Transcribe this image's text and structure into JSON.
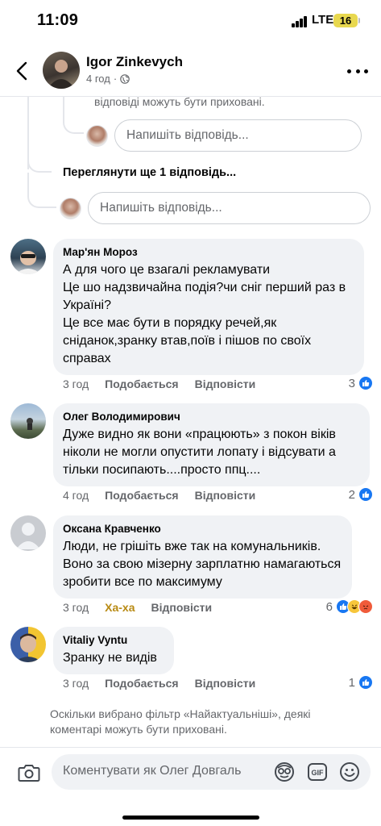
{
  "status_bar": {
    "time": "11:09",
    "network": "LTE",
    "battery": "16"
  },
  "header": {
    "author": "Igor Zinkevych",
    "time": "4 год",
    "separator": "·"
  },
  "thread": {
    "faded_notice": "відповіді можуть бути приховані.",
    "reply_placeholder_1": "Напишіть відповідь...",
    "more_replies": "Переглянути ще 1 відповідь...",
    "reply_placeholder_2": "Напишіть відповідь..."
  },
  "comments": [
    {
      "name": "Мар'ян Мороз",
      "text": "А для чого це взагалі рекламувати\nЦе шо надзвичайна подія?чи сніг перший раз в Україні?\nЦе все має бути в порядку речей,як сніданок,зранку втав,поїв і пішов по своїх справах",
      "time": "3 год",
      "like_label": "Подобається",
      "reply_label": "Відповісти",
      "reaction_count": "3",
      "reactions": [
        "like"
      ]
    },
    {
      "name": "Олег Володимирович",
      "text": "Дуже видно як вони «працюють» з покон віків ніколи не могли опустити лопату і відсувати а тільки посипають....просто ппц....",
      "time": "4 год",
      "like_label": "Подобається",
      "reply_label": "Відповісти",
      "reaction_count": "2",
      "reactions": [
        "like"
      ]
    },
    {
      "name": "Оксана Кравченко",
      "text": "Люди, не грішіть вже так на комунальників. Воно за свою мізерну зарплатню намагаються зробити все по максимуму",
      "time": "3 год",
      "like_label": "Ха-ха",
      "reply_label": "Відповісти",
      "reaction_count": "6",
      "reactions": [
        "like",
        "haha",
        "angry"
      ]
    },
    {
      "name": "Vitaliy Vyntu",
      "text": "Зранку не видів",
      "time": "3 год",
      "like_label": "Подобається",
      "reply_label": "Відповісти",
      "reaction_count": "1",
      "reactions": [
        "like"
      ]
    }
  ],
  "filter_notice": "Оскільки вибрано фільтр «Найактуальніші», деякі коментарі можуть бути приховані.",
  "composer": {
    "placeholder": "Коментувати як Олег Довгаль",
    "gif_label": "GIF"
  },
  "colors": {
    "accent": "#1877f2",
    "haha": "#b88a13",
    "bubble": "#f0f2f5",
    "muted": "#65676b"
  }
}
